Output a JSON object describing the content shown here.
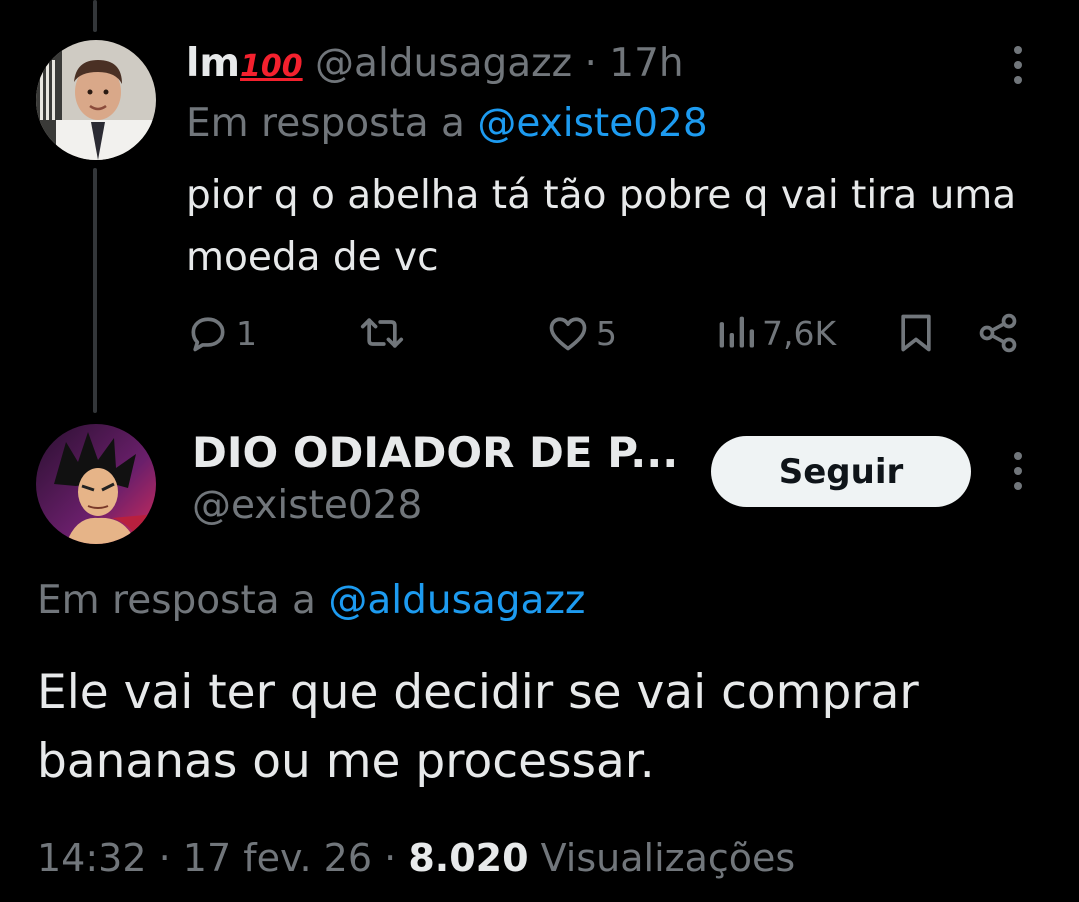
{
  "reply": {
    "author_name": "lm",
    "author_badge": "100",
    "author_handle": "@aldusagazz",
    "separator": "·",
    "time": "17h",
    "reply_to_prefix": "Em resposta a",
    "reply_to_handle": "@existe028",
    "text": "pior q o abelha tá tão pobre q vai tira uma moeda de vc",
    "actions": {
      "reply_count": "1",
      "retweet_count": "",
      "like_count": "5",
      "views_count": "7,6K"
    }
  },
  "main": {
    "author_name": "DIO ODIADOR DE P...",
    "author_handle": "@existe028",
    "follow_label": "Seguir",
    "reply_to_prefix": "Em resposta a",
    "reply_to_handle": "@aldusagazz",
    "text": "Ele vai ter que decidir se vai comprar bananas ou me processar.",
    "time": "14:32",
    "sep1": "·",
    "date": "17 fev. 26",
    "sep2": "·",
    "views_number": "8.020",
    "views_label": "Visualizações"
  },
  "icons": {
    "reply": "comment-icon",
    "retweet": "retweet-icon",
    "like": "heart-icon",
    "views": "views-icon",
    "bookmark": "bookmark-icon",
    "share": "share-icon",
    "more": "more-vertical-icon"
  },
  "colors": {
    "background": "#000000",
    "text": "#e7e9ea",
    "muted": "#71767b",
    "link": "#1d9bf0",
    "follow_button_bg": "#eff3f4"
  }
}
